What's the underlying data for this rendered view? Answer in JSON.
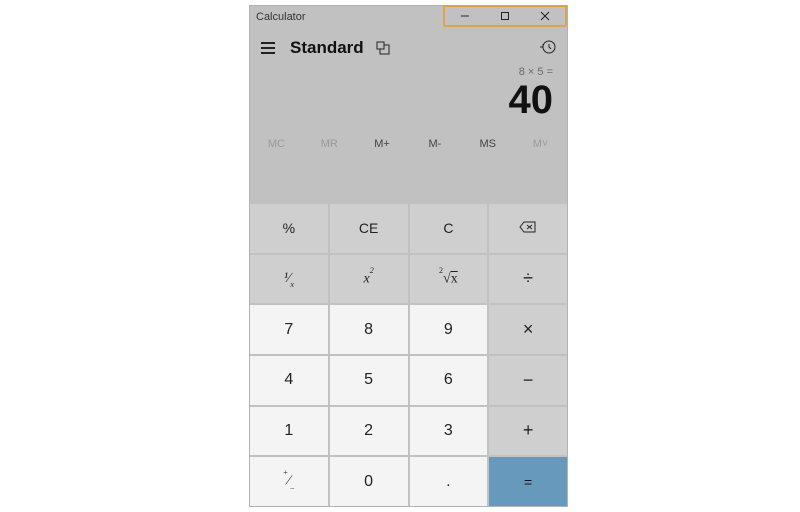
{
  "window": {
    "title": "Calculator"
  },
  "header": {
    "mode": "Standard"
  },
  "display": {
    "expression": "8 × 5 =",
    "result": "40"
  },
  "memory": {
    "mc": "MC",
    "mr": "MR",
    "mplus": "M+",
    "mminus": "M-",
    "ms": "MS",
    "mlist": "M˅"
  },
  "keys": {
    "percent": "%",
    "ce": "CE",
    "c": "C",
    "n7": "7",
    "n8": "8",
    "n9": "9",
    "n4": "4",
    "n5": "5",
    "n6": "6",
    "n1": "1",
    "n2": "2",
    "n3": "3",
    "n0": "0",
    "dot": ".",
    "mul": "×",
    "sub": "−",
    "add": "+",
    "div": "÷",
    "eq": "="
  }
}
